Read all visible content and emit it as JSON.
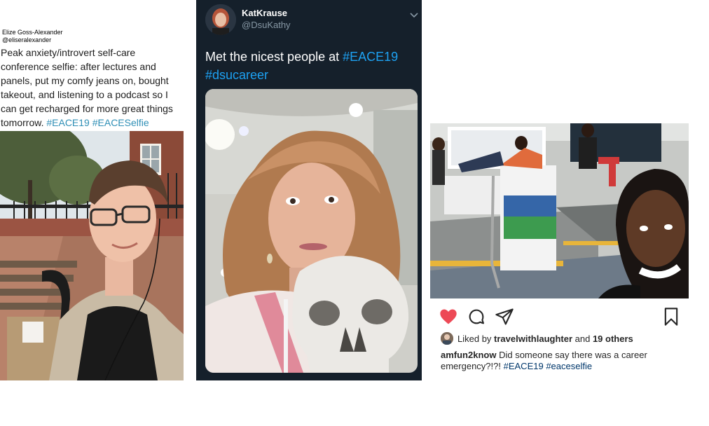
{
  "post1": {
    "author_name": "Elize Goss-Alexander",
    "author_handle": "@eliseralexander",
    "text_parts": [
      "Peak anxiety/introvert self-care conference selfie: after lectures and panels, put my comfy jeans on, bought takeout, and listening to a podcast so I can get recharged for more great things tomorrow. ",
      "#EACE19",
      " ",
      "#EACESelfie"
    ],
    "tag_color": "#2f8fb6"
  },
  "post2": {
    "display_name": "KatKrause",
    "handle": "@DsuKathy",
    "text_parts": [
      "Met the nicest people at ",
      "#EACE19",
      " ",
      "#dsucareer"
    ],
    "chevron_icon": "chevron-down-icon",
    "background": "#15202b",
    "tag_color": "#1da1f2"
  },
  "post3": {
    "action_icons": [
      "heart-icon",
      "comment-icon",
      "share-icon",
      "bookmark-icon"
    ],
    "liked_prefix": "Liked by ",
    "liked_user": "travelwithlaughter",
    "liked_mid": " and ",
    "liked_count": "19 others",
    "caption_user": "amfun2know",
    "caption_text": " Did someone say there was a career emergency?!?! ",
    "caption_tag1": "#EACE19",
    "caption_space": " ",
    "caption_tag2": "#eaceselfie",
    "heart_color": "#ed4956"
  }
}
